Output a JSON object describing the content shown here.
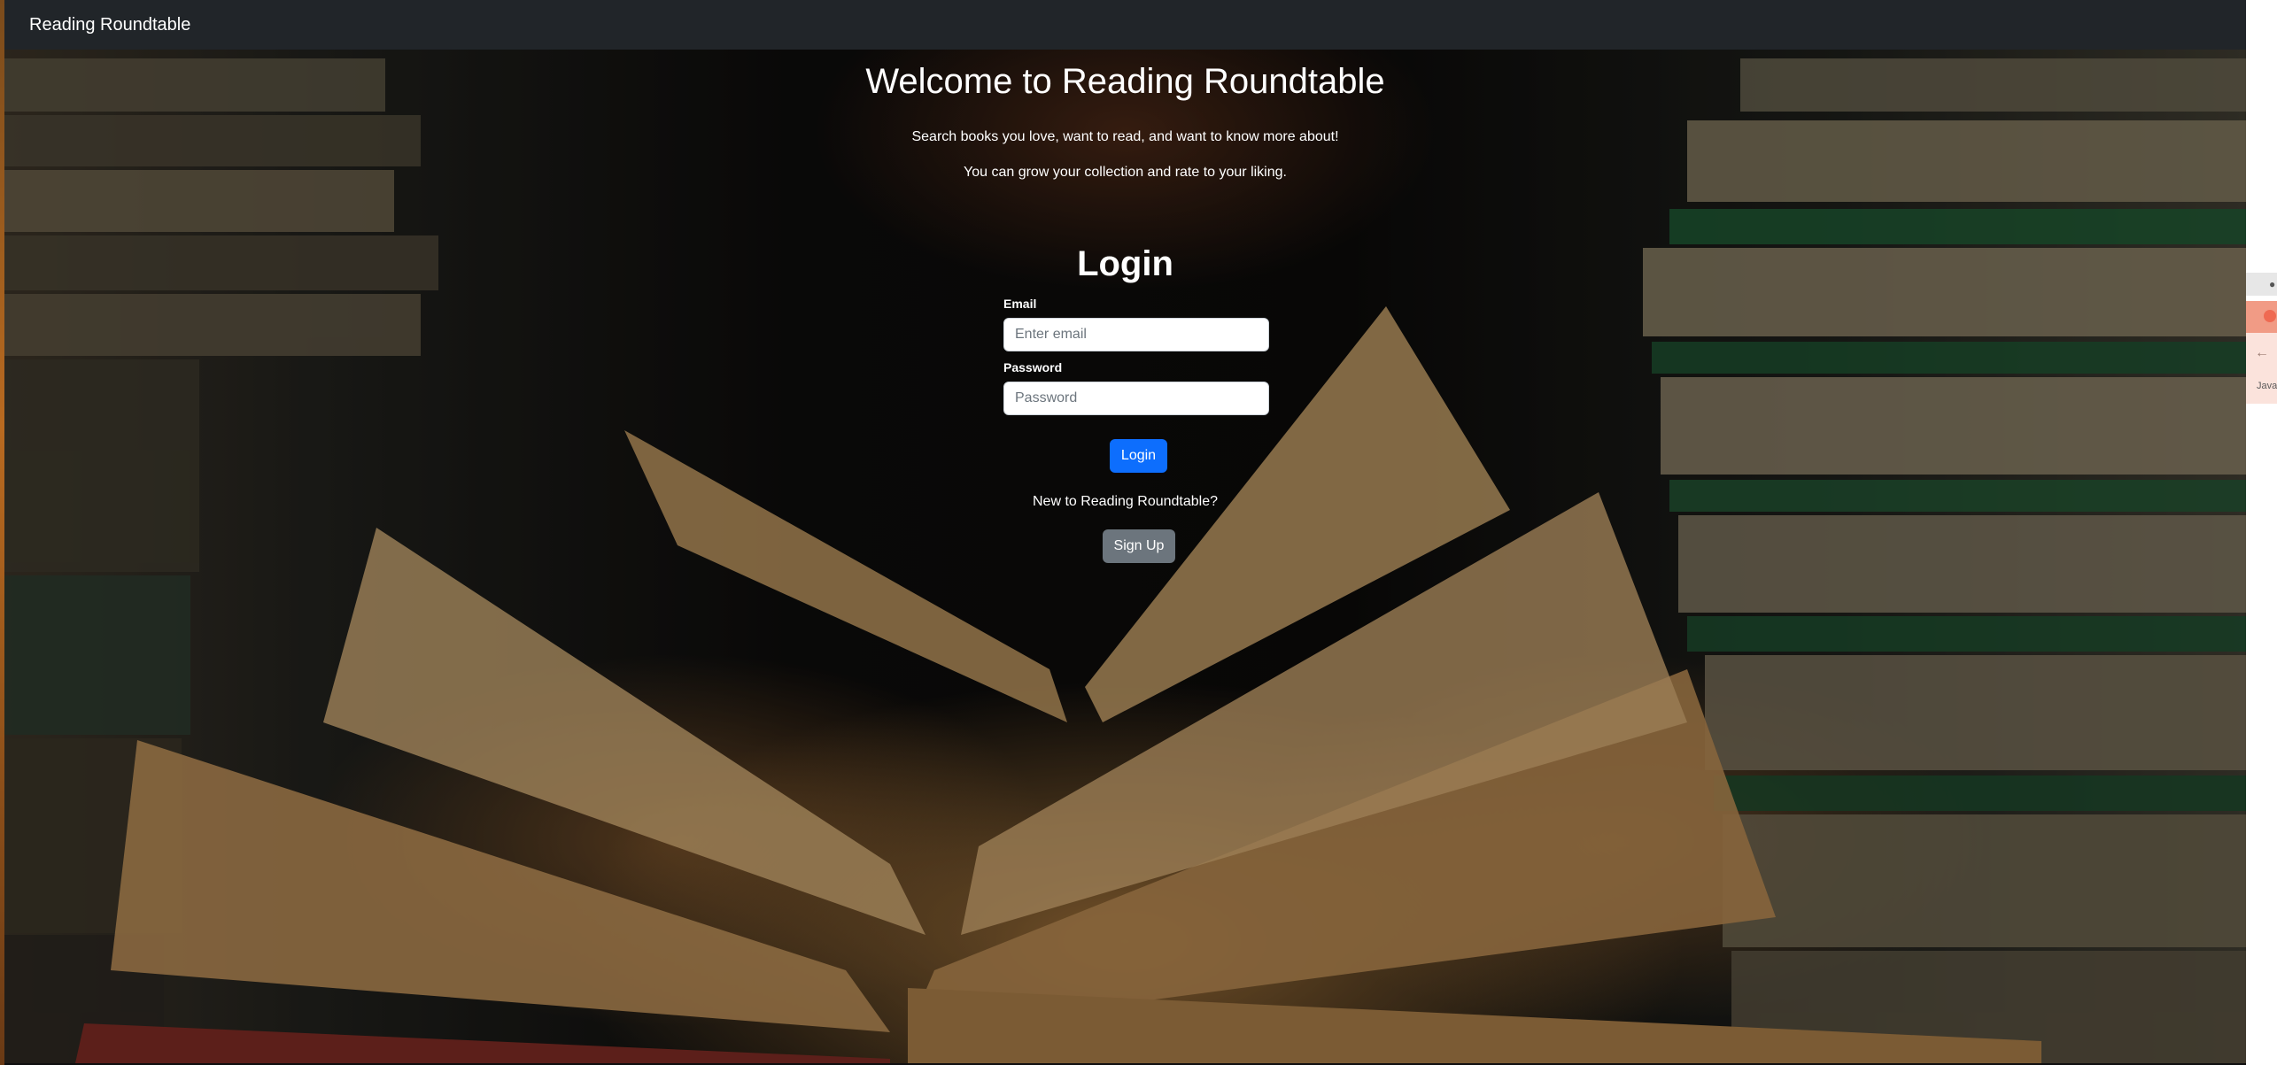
{
  "navbar": {
    "brand": "Reading Roundtable"
  },
  "hero": {
    "title": "Welcome to Reading Roundtable",
    "subtitle_1": "Search books you love, want to read, and want to know more about!",
    "subtitle_2": "You can grow your collection and rate to your liking."
  },
  "login": {
    "title": "Login",
    "email_label": "Email",
    "email_placeholder": "Enter email",
    "email_value": "",
    "password_label": "Password",
    "password_placeholder": "Password",
    "password_value": "",
    "submit_label": "Login",
    "signup_prompt": "New to Reading Roundtable?",
    "signup_label": "Sign Up"
  },
  "side_window": {
    "text": "Java"
  },
  "colors": {
    "navbar_bg": "#212529",
    "primary_button": "#0d6efd",
    "secondary_button": "#6c757d",
    "text": "#ffffff"
  },
  "icons": {
    "side_window_menu": "apple-icon",
    "side_window_back": "back-arrow-icon"
  }
}
